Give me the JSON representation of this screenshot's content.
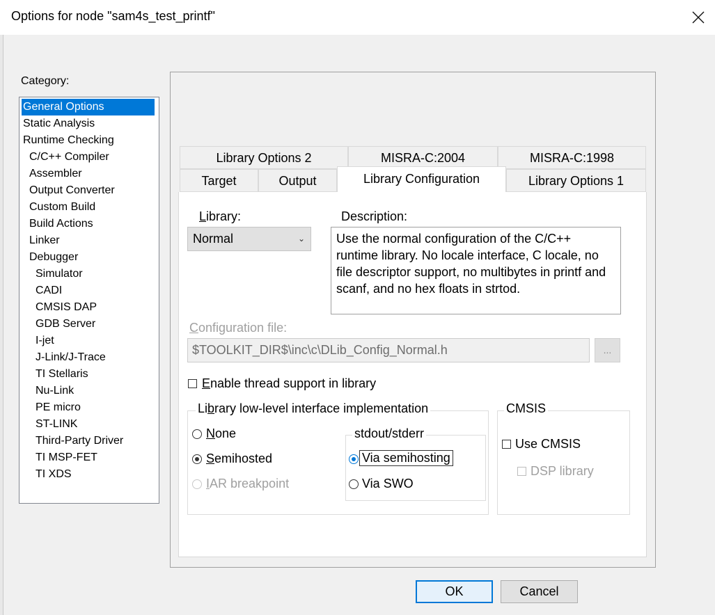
{
  "window": {
    "title": "Options for node \"sam4s_test_printf\""
  },
  "category": {
    "label": "Category:",
    "items": [
      {
        "label": "General Options",
        "indent": 0,
        "selected": true
      },
      {
        "label": "Static Analysis",
        "indent": 0
      },
      {
        "label": "Runtime Checking",
        "indent": 0
      },
      {
        "label": "C/C++ Compiler",
        "indent": 1
      },
      {
        "label": "Assembler",
        "indent": 1
      },
      {
        "label": "Output Converter",
        "indent": 1
      },
      {
        "label": "Custom Build",
        "indent": 1
      },
      {
        "label": "Build Actions",
        "indent": 1
      },
      {
        "label": "Linker",
        "indent": 1
      },
      {
        "label": "Debugger",
        "indent": 1
      },
      {
        "label": "Simulator",
        "indent": 2
      },
      {
        "label": "CADI",
        "indent": 2
      },
      {
        "label": "CMSIS DAP",
        "indent": 2
      },
      {
        "label": "GDB Server",
        "indent": 2
      },
      {
        "label": "I-jet",
        "indent": 2
      },
      {
        "label": "J-Link/J-Trace",
        "indent": 2
      },
      {
        "label": "TI Stellaris",
        "indent": 2
      },
      {
        "label": "Nu-Link",
        "indent": 2
      },
      {
        "label": "PE micro",
        "indent": 2
      },
      {
        "label": "ST-LINK",
        "indent": 2
      },
      {
        "label": "Third-Party Driver",
        "indent": 2
      },
      {
        "label": "TI MSP-FET",
        "indent": 2
      },
      {
        "label": "TI XDS",
        "indent": 2
      }
    ]
  },
  "tabs": {
    "row1": [
      "Library Options 2",
      "MISRA-C:2004",
      "MISRA-C:1998"
    ],
    "row2": [
      "Target",
      "Output",
      "Library Configuration",
      "Library Options 1"
    ],
    "active": "Library Configuration"
  },
  "library": {
    "label_first": "L",
    "label_rest": "ibrary:",
    "value": "Normal",
    "description_label": "Description:",
    "description": "Use the normal configuration of the C/C++ runtime library. No locale interface, C locale, no file descriptor support, no multibytes in printf and scanf, and no hex floats in strtod."
  },
  "config_file": {
    "label_first": "C",
    "label_rest": "onfiguration file:",
    "value": "$TOOLKIT_DIR$\\inc\\c\\DLib_Config_Normal.h",
    "browse": "..."
  },
  "thread_support": {
    "label_first": "E",
    "label_rest": "nable thread support in library",
    "checked": false
  },
  "low_level": {
    "title_a": "Li",
    "title_b": "b",
    "title_c": "rary low-level interface implementation",
    "none_first": "N",
    "none_rest": "one",
    "semihosted_first": "S",
    "semihosted_rest": "emihosted",
    "iar_first": "I",
    "iar_rest": "AR breakpoint",
    "selected": "Semihosted"
  },
  "stdout": {
    "title": "stdout/stderr",
    "via_semihosting": "Via semihosting",
    "via_swo": "Via SWO",
    "selected": "Via semihosting"
  },
  "cmsis": {
    "title": "CMSIS",
    "use_cmsis": "Use CMSIS",
    "dsp_library": "DSP library"
  },
  "buttons": {
    "ok": "OK",
    "cancel": "Cancel"
  }
}
